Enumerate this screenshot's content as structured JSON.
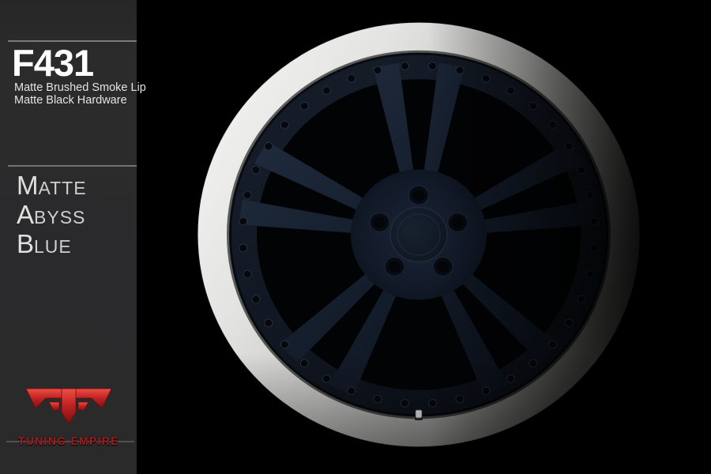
{
  "panel": {
    "model": "F431",
    "finish_line1": "Matte Brushed Smoke Lip",
    "finish_line2": "Matte Black Hardware",
    "color_name": [
      {
        "initial": "M",
        "rest": "ATTE"
      },
      {
        "initial": "A",
        "rest": "BYSS"
      },
      {
        "initial": "B",
        "rest": "LUE"
      }
    ]
  },
  "brand": {
    "monogram": "JF",
    "name": "TUNING EMPIRE"
  },
  "wheel": {
    "description": "F431 forged wheel, matte abyss blue face, brushed smoke lip, matte black hardware",
    "colors": {
      "background": "#000000",
      "panel_gray": "#2a2a2b",
      "lip_bright": "#f7f7f5",
      "lip_mid": "#c6c6c4",
      "lip_dark": "#6b6b69",
      "face_navy": "#16202f",
      "face_navy_light": "#243044",
      "band_navy": "#0d1219",
      "window_black": "#020305",
      "hardware_black": "#05070b",
      "rivet_ring": "#273141",
      "accent_red": "#c32424",
      "text_white": "#ffffff",
      "text_gray": "#cfcfcf"
    }
  }
}
